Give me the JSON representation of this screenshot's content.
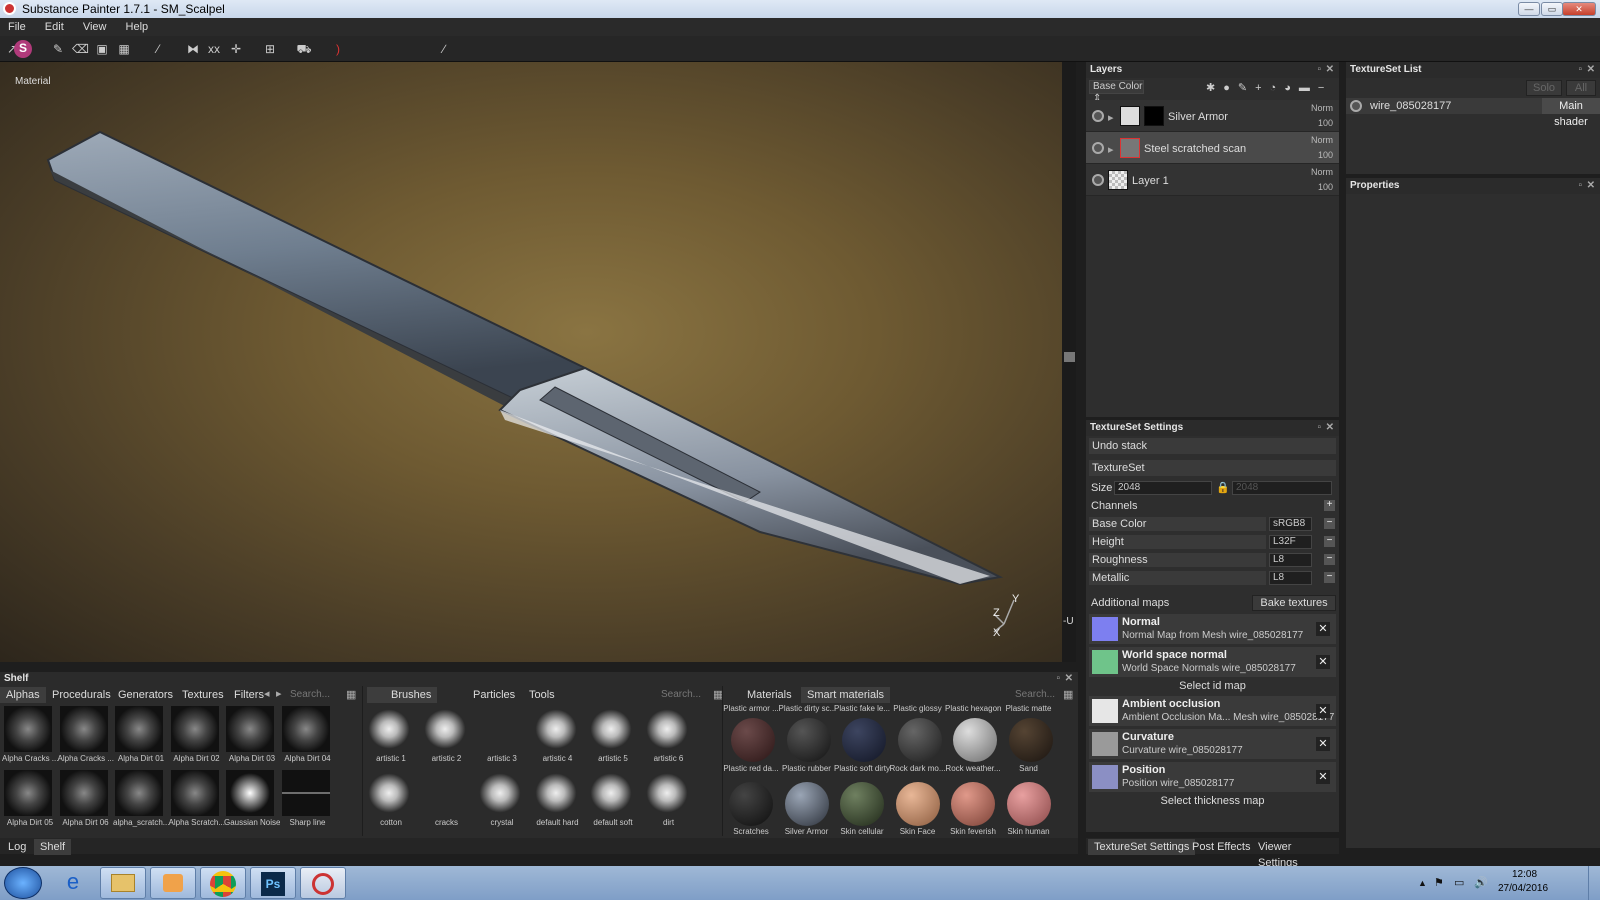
{
  "window": {
    "title": "Substance Painter 1.7.1 - SM_Scalpel"
  },
  "menu": [
    "File",
    "Edit",
    "View",
    "Help"
  ],
  "toolbar": {
    "brush_size": "8"
  },
  "viewport": {
    "label": "Material",
    "axis_y": "Y",
    "axis_z": "Z",
    "axis_x": "X",
    "u_label": "-U"
  },
  "layers": {
    "title": "Layers",
    "channel": "Base Color",
    "items": [
      {
        "name": "Silver Armor",
        "blend": "Norm",
        "opacity": "100"
      },
      {
        "name": "Steel scratched scan",
        "blend": "Norm",
        "opacity": "100"
      },
      {
        "name": "Layer 1",
        "blend": "Norm",
        "opacity": "100"
      }
    ]
  },
  "texture_set_list": {
    "title": "TextureSet List",
    "solo": "Solo",
    "all": "All",
    "item": "wire_085028177",
    "shader": "Main shader"
  },
  "properties": {
    "title": "Properties"
  },
  "texture_set_settings": {
    "title": "TextureSet Settings",
    "undo_stack": "Undo stack",
    "texture_set": "TextureSet",
    "size_label": "Size",
    "size_value": "2048",
    "size_value2": "2048",
    "channels_label": "Channels",
    "channels": [
      {
        "name": "Base Color",
        "format": "sRGB8"
      },
      {
        "name": "Height",
        "format": "L32F"
      },
      {
        "name": "Roughness",
        "format": "L8"
      },
      {
        "name": "Metallic",
        "format": "L8"
      }
    ],
    "additional_maps": "Additional maps",
    "bake_textures": "Bake textures",
    "maps": [
      {
        "title": "Normal",
        "desc": "Normal Map from Mesh wire_085028177",
        "color": "#7d7ff0"
      },
      {
        "title": "World space normal",
        "desc": "World Space Normals wire_085028177",
        "color": "#6fc48a"
      },
      {
        "title": "Ambient occlusion",
        "desc": "Ambient Occlusion Ma... Mesh wire_085028177",
        "color": "#e6e6e6"
      },
      {
        "title": "Curvature",
        "desc": "Curvature wire_085028177",
        "color": "#9a9a9a"
      },
      {
        "title": "Position",
        "desc": "Position wire_085028177",
        "color": "#8b8fc4"
      }
    ],
    "select_id_map": "Select id map",
    "select_thickness_map": "Select thickness map"
  },
  "shelf": {
    "title": "Shelf",
    "tabs": [
      "Alphas",
      "Procedurals",
      "Generators",
      "Textures",
      "Filters"
    ],
    "search": "Search...",
    "alphas": [
      "Alpha Cracks ...",
      "Alpha Cracks ...",
      "Alpha Dirt 01",
      "Alpha Dirt 02",
      "Alpha Dirt 03",
      "Alpha Dirt 04",
      "Alpha Dirt 05",
      "Alpha Dirt 06",
      "alpha_scratch...",
      "Alpha Scratch...",
      "Gaussian Noise",
      "Sharp line"
    ],
    "brush_tabs": [
      "Brushes",
      "Particles",
      "Tools"
    ],
    "brushes": [
      "artistic 1",
      "artistic 2",
      "artistic 3",
      "artistic 4",
      "artistic 5",
      "artistic 6",
      "cotton",
      "cracks",
      "crystal",
      "default hard",
      "default soft",
      "dirt"
    ],
    "material_tabs": [
      "Materials",
      "Smart materials"
    ],
    "materials_top": [
      "Plastic armor ...",
      "Plastic dirty sc...",
      "Plastic fake le...",
      "Plastic glossy",
      "Plastic hexagon",
      "Plastic matte"
    ],
    "materials_mid": [
      "Plastic red da...",
      "Plastic rubber",
      "Plastic soft dirty",
      "Rock dark mo...",
      "Rock weather...",
      "Sand"
    ],
    "materials_bottom": [
      "Scratches",
      "Silver Armor",
      "Skin cellular",
      "Skin Face",
      "Skin feverish",
      "Skin human"
    ]
  },
  "bottom_tabs": [
    "Log",
    "Shelf"
  ],
  "right_bottom_tabs": [
    "TextureSet Settings",
    "Post Effects",
    "Viewer Settings"
  ],
  "taskbar": {
    "time": "12:08",
    "date": "27/04/2016"
  }
}
